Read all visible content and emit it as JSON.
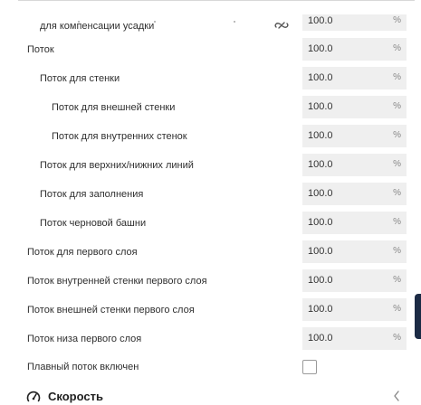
{
  "rows": [
    {
      "label": "для компенсации усадки",
      "value": "100.0",
      "unit": "%"
    },
    {
      "label": "Поток",
      "value": "100.0",
      "unit": "%"
    },
    {
      "label": "Поток для стенки",
      "value": "100.0",
      "unit": "%"
    },
    {
      "label": "Поток для внешней стенки",
      "value": "100.0",
      "unit": "%"
    },
    {
      "label": "Поток для внутренних стенок",
      "value": "100.0",
      "unit": "%"
    },
    {
      "label": "Поток для верхних/нижних линий",
      "value": "100.0",
      "unit": "%"
    },
    {
      "label": "Поток для заполнения",
      "value": "100.0",
      "unit": "%"
    },
    {
      "label": "Поток черновой башни",
      "value": "100.0",
      "unit": "%"
    },
    {
      "label": "Поток для первого слоя",
      "value": "100.0",
      "unit": "%"
    },
    {
      "label": "Поток внутренней стенки первого слоя",
      "value": "100.0",
      "unit": "%"
    },
    {
      "label": "Поток внешней стенки первого слоя",
      "value": "100.0",
      "unit": "%"
    },
    {
      "label": "Поток низа первого слоя",
      "value": "100.0",
      "unit": "%"
    }
  ],
  "smooth_flow": {
    "label": "Плавный поток включен",
    "checked": false
  },
  "section": {
    "label": "Скорость",
    "icon": "speedometer-icon",
    "chevron": "chevron-left-icon"
  },
  "icons": {
    "link": "link-icon"
  },
  "colors": {
    "field_bg": "#efefef",
    "side_tab": "#1c2b45"
  }
}
